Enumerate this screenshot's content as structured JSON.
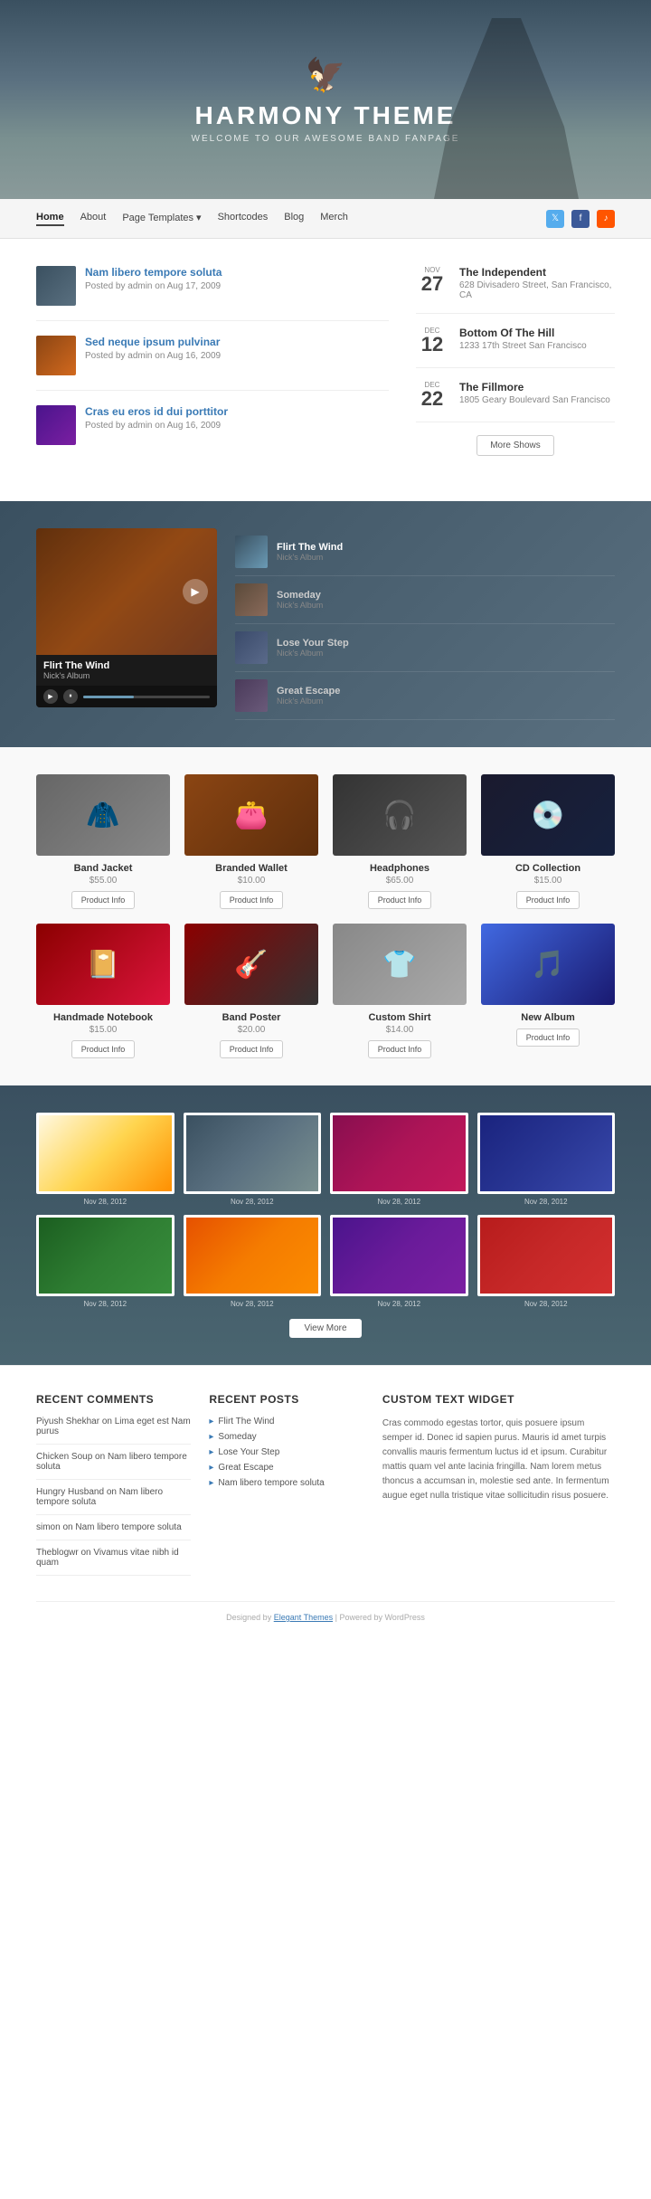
{
  "site": {
    "title": "HARMONY THEME",
    "subtitle": "WELCOME TO OUR AWESOME BAND FANPAGE"
  },
  "nav": {
    "links": [
      {
        "label": "Home",
        "active": true
      },
      {
        "label": "About",
        "active": false
      },
      {
        "label": "Page Templates ▾",
        "active": false
      },
      {
        "label": "Shortcodes",
        "active": false
      },
      {
        "label": "Blog",
        "active": false
      },
      {
        "label": "Merch",
        "active": false
      }
    ],
    "social": [
      "𝕏",
      "f",
      "♪"
    ]
  },
  "blog_posts": [
    {
      "title": "Nam libero tempore soluta",
      "meta": "Posted by admin on Aug 17, 2009"
    },
    {
      "title": "Sed neque ipsum pulvinar",
      "meta": "Posted by admin on Aug 16, 2009"
    },
    {
      "title": "Cras eu eros id dui porttitor",
      "meta": "Posted by admin on Aug 16, 2009"
    }
  ],
  "events": [
    {
      "month": "NOV",
      "day": "27",
      "title": "The Independent",
      "venue": "628 Divisadero Street, San Francisco, CA"
    },
    {
      "month": "DEC",
      "day": "12",
      "title": "Bottom Of The Hill",
      "venue": "1233 17th Street San Francisco"
    },
    {
      "month": "DEC",
      "day": "22",
      "title": "The Fillmore",
      "venue": "1805 Geary Boulevard San Francisco"
    }
  ],
  "events_more_btn": "More Shows",
  "player": {
    "song_title": "Flirt The Wind",
    "album": "Nick's Album"
  },
  "playlist": [
    {
      "title": "Flirt The Wind",
      "album": "Nick's Album",
      "active": true
    },
    {
      "title": "Someday",
      "album": "Nick's Album",
      "active": false
    },
    {
      "title": "Lose Your Step",
      "album": "Nick's Album",
      "active": false
    },
    {
      "title": "Great Escape",
      "album": "Nick's Album",
      "active": false
    }
  ],
  "shop_items": [
    {
      "name": "Band Jacket",
      "price": "$55.00",
      "btn": "Product Info",
      "img_class": "jacket-img"
    },
    {
      "name": "Branded Wallet",
      "price": "$10.00",
      "btn": "Product Info",
      "img_class": "wallet-img"
    },
    {
      "name": "Headphones",
      "price": "$65.00",
      "btn": "Product Info",
      "img_class": "headphones-img"
    },
    {
      "name": "CD Collection",
      "price": "$15.00",
      "btn": "Product Info",
      "img_class": "cd-img"
    },
    {
      "name": "Handmade Notebook",
      "price": "$15.00",
      "btn": "Product Info",
      "img_class": "notebook-img"
    },
    {
      "name": "Band Poster",
      "price": "$20.00",
      "btn": "Product Info",
      "img_class": "poster-img"
    },
    {
      "name": "Custom Shirt",
      "price": "$14.00",
      "btn": "Product Info",
      "img_class": "shirt-img"
    },
    {
      "name": "New Album",
      "price": "",
      "btn": "Product Info",
      "img_class": "album-img"
    }
  ],
  "gallery": {
    "photos": [
      {
        "date": "Nov 28, 2012",
        "color_class": "gp1"
      },
      {
        "date": "Nov 28, 2012",
        "color_class": "gp2"
      },
      {
        "date": "Nov 28, 2012",
        "color_class": "gp3"
      },
      {
        "date": "Nov 28, 2012",
        "color_class": "gp4"
      },
      {
        "date": "Nov 28, 2012",
        "color_class": "gp5"
      },
      {
        "date": "Nov 28, 2012",
        "color_class": "gp6"
      },
      {
        "date": "Nov 28, 2012",
        "color_class": "gp7"
      },
      {
        "date": "Nov 28, 2012",
        "color_class": "gp8"
      }
    ],
    "view_more_btn": "View More"
  },
  "footer": {
    "recent_comments_title": "Recent Comments",
    "recent_comments": [
      {
        "text": "Piyush Shekhar on Lima eget est Nam purus"
      },
      {
        "text": "Chicken Soup on Nam libero tempore soluta"
      },
      {
        "text": "Hungry Husband on Nam libero tempore soluta"
      },
      {
        "text": "simon on Nam libero tempore soluta"
      },
      {
        "text": "Theblogwr on Vivamus vitae nibh id quam"
      }
    ],
    "recent_posts_title": "Recent Posts",
    "recent_posts": [
      {
        "title": "Flirt The Wind"
      },
      {
        "title": "Someday"
      },
      {
        "title": "Lose Your Step"
      },
      {
        "title": "Great Escape"
      },
      {
        "title": "Nam libero tempore soluta"
      }
    ],
    "custom_widget_title": "Custom Text Widget",
    "custom_widget_text": "Cras commodo egestas tortor, quis posuere ipsum semper id. Donec id sapien purus. Mauris id amet turpis convallis mauris fermentum luctus id et ipsum. Curabitur mattis quam vel ante lacinia fringilla. Nam lorem metus thoncus a accumsan in, molestie sed ante. In fermentum augue eget nulla tristique vitae sollicitudin risus posuere.",
    "bottom_text": "Designed by",
    "bottom_link": "Elegant Themes",
    "bottom_suffix": "| Powered by WordPress"
  }
}
